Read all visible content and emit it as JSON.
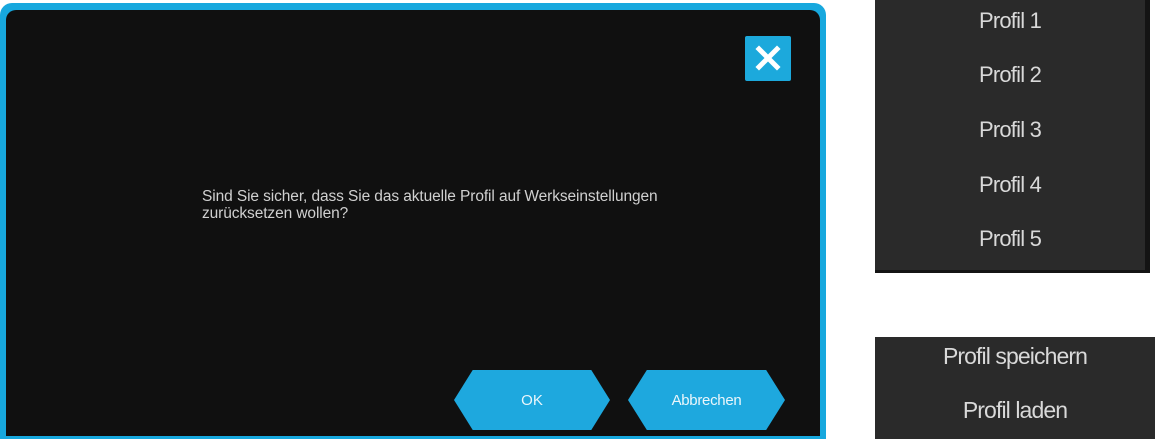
{
  "dialog": {
    "close_icon": "close-icon",
    "message_line1": "Sind Sie sicher, dass Sie das aktuelle Profil auf Werkseinstellungen",
    "message_line2": "zurücksetzen wollen?",
    "ok_label": "OK",
    "cancel_label": "Abbrechen",
    "accent_color": "#1ca9dc",
    "background_color": "#101010"
  },
  "profile_menu": {
    "items": [
      {
        "label": "Profil 1"
      },
      {
        "label": "Profil 2"
      },
      {
        "label": "Profil 3"
      },
      {
        "label": "Profil 4"
      },
      {
        "label": "Profil 5"
      }
    ]
  },
  "action_menu": {
    "items": [
      {
        "label": "Profil speichern"
      },
      {
        "label": "Profil laden"
      }
    ]
  }
}
